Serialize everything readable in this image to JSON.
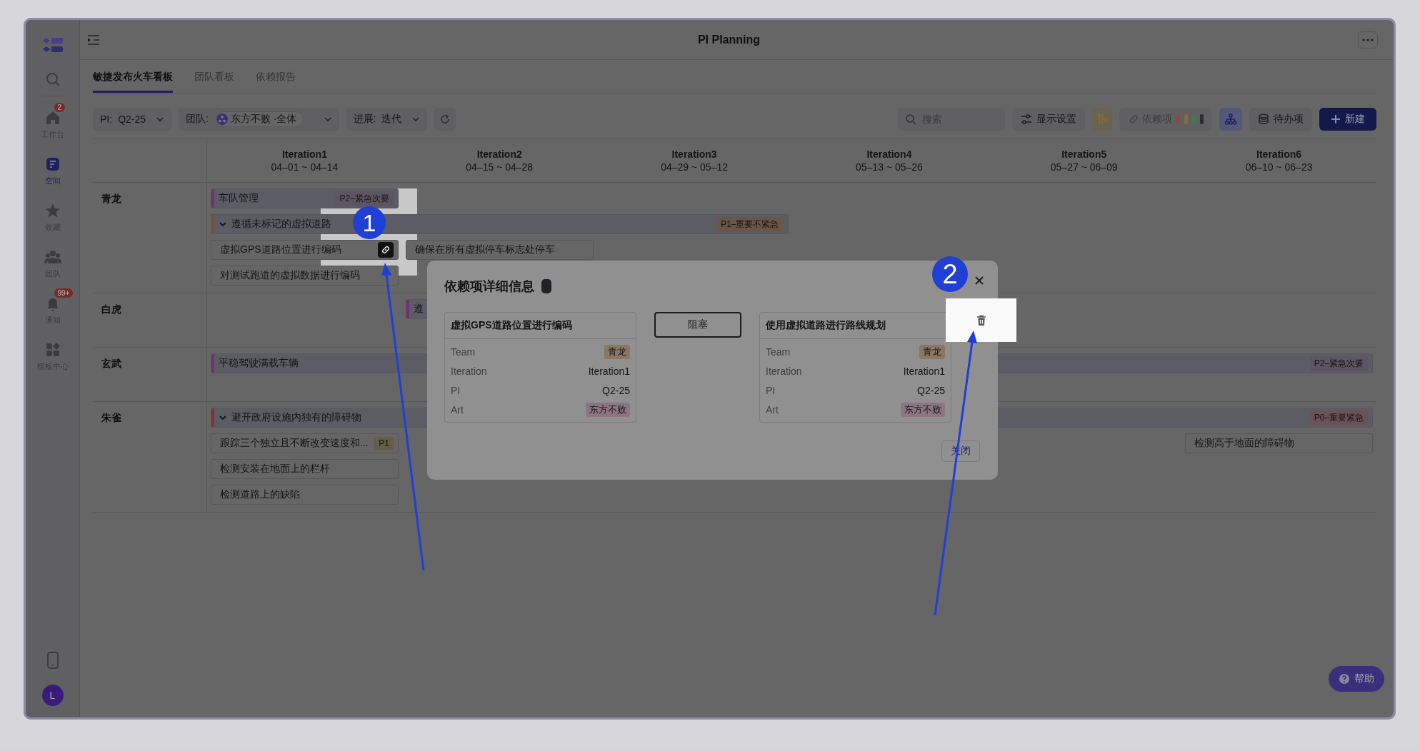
{
  "sidebar": {
    "nav": [
      {
        "kind": "home",
        "label": "工作台",
        "badge": "2",
        "selected": false
      },
      {
        "kind": "space",
        "label": "空间",
        "selected": true
      },
      {
        "kind": "star",
        "label": "收藏",
        "selected": false
      },
      {
        "kind": "team",
        "label": "团队",
        "selected": false
      },
      {
        "kind": "bell",
        "label": "通知",
        "badge": "99+",
        "selected": false
      },
      {
        "kind": "grid",
        "label": "模板中心",
        "selected": false
      }
    ],
    "avatar": "L"
  },
  "header": {
    "title": "PI Planning"
  },
  "tabs": [
    {
      "label": "敏捷发布火车看板",
      "selected": true
    },
    {
      "label": "团队看板",
      "selected": false
    },
    {
      "label": "依赖报告",
      "selected": false
    }
  ],
  "filters": [
    {
      "kind": "select",
      "label": "PI:",
      "value": "Q2-25"
    },
    {
      "kind": "team",
      "label": "团队:",
      "value": "东方不败 ·全体"
    },
    {
      "kind": "select",
      "label": "进展:",
      "value": "迭代"
    }
  ],
  "toolbar": {
    "search": {
      "placeholder": "搜索"
    },
    "display_settings": "显示设置",
    "dependencies": {
      "label": "依赖项",
      "legend": [
        {
          "color": "#8a4a4a"
        },
        {
          "color": "#8a6a48"
        },
        {
          "color": "#3f7a4a"
        },
        {
          "color": "#2e2e2e"
        }
      ]
    },
    "hierarchy_view": {
      "selected": true
    },
    "backlog": "待办项",
    "new_button": "新建"
  },
  "board": {
    "iterations": [
      {
        "name": "Iteration1",
        "dates": "04–01 ~ 04–14"
      },
      {
        "name": "Iteration2",
        "dates": "04–15 ~ 04–28"
      },
      {
        "name": "Iteration3",
        "dates": "04–29 ~ 05–12"
      },
      {
        "name": "Iteration4",
        "dates": "05–13 ~ 05–26"
      },
      {
        "name": "Iteration5",
        "dates": "05–27 ~ 06–09"
      },
      {
        "name": "Iteration6",
        "dates": "06–10 ~ 06–23"
      }
    ],
    "teams": [
      {
        "name": "青龙",
        "lines": [
          [
            {
              "kind": "feature",
              "title": "车队管理",
              "color": "#7a2a7a",
              "badge": {
                "text": "P2–紧急次要",
                "color": "#5e5563"
              }
            }
          ],
          [
            {
              "kind": "epic",
              "title": "遵循未标记的虚拟道路",
              "color": "#845022",
              "expanded": true,
              "badge": {
                "text": "P1–重要不紧急",
                "color": "#6a5648"
              }
            },
            {
              "kind": "continued"
            },
            {
              "kind": "continued"
            }
          ],
          [
            {
              "kind": "story",
              "title": "虚拟GPS道路位置进行编码",
              "linked": true
            },
            {
              "kind": "story",
              "title": "确保在所有虚拟停车标志处停车",
              "linked": false
            }
          ],
          [
            {
              "kind": "story",
              "title": "对测试跑道的虚拟数据进行编码",
              "linked": false
            }
          ]
        ]
      },
      {
        "name": "白虎",
        "lines": [
          [
            {
              "kind": "empty"
            },
            {
              "kind": "feature",
              "title": "遵",
              "color": "#7a2a7a"
            }
          ]
        ]
      },
      {
        "name": "玄武",
        "lines": [
          [
            {
              "kind": "feature",
              "title": "平稳驾驶满载车辆",
              "color": "#7a2a7a",
              "badge": {
                "text": "P2–紧急次要",
                "color": "#5e5563"
              }
            },
            {
              "kind": "continued"
            },
            {
              "kind": "continued"
            },
            {
              "kind": "continued"
            },
            {
              "kind": "continued"
            },
            {
              "kind": "continued"
            }
          ]
        ]
      },
      {
        "name": "朱雀",
        "lines": [
          [
            {
              "kind": "epic",
              "title": "避开政府设施内独有的障碍物",
              "color": "#8a2f2f",
              "expanded": true,
              "badge": {
                "text": "P0–重要紧急",
                "color": "#6a5257"
              }
            },
            {
              "kind": "continued"
            },
            {
              "kind": "continued"
            },
            {
              "kind": "continued"
            },
            {
              "kind": "continued"
            },
            {
              "kind": "continued"
            }
          ],
          [
            {
              "kind": "story",
              "title": "跟踪三个独立且不断改变速度和...",
              "linked": false,
              "badge": {
                "text": "P1",
                "color": "#665e48"
              }
            },
            {
              "kind": "empty"
            },
            {
              "kind": "empty"
            },
            {
              "kind": "empty"
            },
            {
              "kind": "empty"
            },
            {
              "kind": "story",
              "title": "检测高于地面的障碍物",
              "linked": false
            }
          ],
          [
            {
              "kind": "story",
              "title": "检测安装在地面上的栏杆",
              "linked": false
            }
          ],
          [
            {
              "kind": "story",
              "title": "检测道路上的缺陷",
              "linked": false
            }
          ]
        ]
      }
    ]
  },
  "dependency_dialog": {
    "title": "依赖项详细信息",
    "source": {
      "title": "虚拟GPS道路位置进行编码",
      "fields": [
        {
          "kind": "tag",
          "label": "Team",
          "value": "青龙",
          "color": "#8c7763"
        },
        {
          "kind": "text",
          "label": "Iteration",
          "value": "Iteration1"
        },
        {
          "kind": "text",
          "label": "PI",
          "value": "Q2-25"
        },
        {
          "kind": "tag",
          "label": "Art",
          "value": "东方不败",
          "color": "#8c7480"
        }
      ]
    },
    "relation": "阻塞",
    "target": {
      "title": "使用虚拟道路进行路线规划",
      "fields": [
        {
          "kind": "tag",
          "label": "Team",
          "value": "青龙",
          "color": "#8c7763"
        },
        {
          "kind": "text",
          "label": "Iteration",
          "value": "Iteration1"
        },
        {
          "kind": "text",
          "label": "PI",
          "value": "Q2-25"
        },
        {
          "kind": "tag",
          "label": "Art",
          "value": "东方不败",
          "color": "#8c7480"
        }
      ]
    },
    "close_button": "关闭"
  },
  "help_button": "帮助",
  "annotations": [
    {
      "number": "1"
    },
    {
      "number": "2"
    }
  ]
}
